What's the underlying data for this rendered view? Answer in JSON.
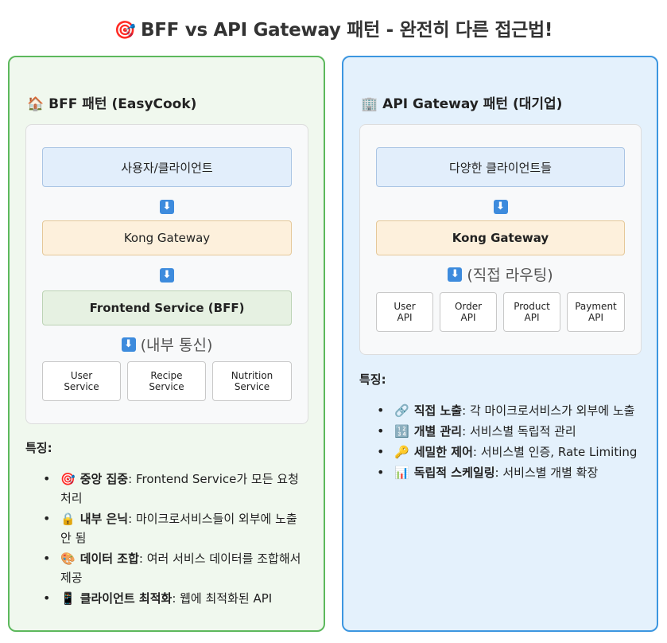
{
  "title": {
    "icon": "🎯",
    "text": "BFF vs API Gateway 패턴 - 완전히 다른 접근법!"
  },
  "bff": {
    "icon": "🏠",
    "title": "BFF 패턴 (EasyCook)",
    "client": "사용자/클라이언트",
    "gateway": "Kong Gateway",
    "frontend": "Frontend Service (BFF)",
    "internal_label": "(내부 통신)",
    "services": [
      "User\nService",
      "Recipe\nService",
      "Nutrition\nService"
    ],
    "features_title": "특징:",
    "features": [
      {
        "icon": "🎯",
        "name": "중앙 집중",
        "desc": ": Frontend Service가 모든 요청 처리"
      },
      {
        "icon": "🔒",
        "name": "내부 은닉",
        "desc": ": 마이크로서비스들이 외부에 노출 안 됨"
      },
      {
        "icon": "🎨",
        "name": "데이터 조합",
        "desc": ": 여러 서비스 데이터를 조합해서 제공"
      },
      {
        "icon": "📱",
        "name": "클라이언트 최적화",
        "desc": ": 웹에 최적화된 API"
      }
    ]
  },
  "gw": {
    "icon": "🏢",
    "title": "API Gateway 패턴 (대기업)",
    "client": "다양한 클라이언트들",
    "gateway": "Kong Gateway",
    "routing_label": "(직접 라우팅)",
    "services": [
      "User\nAPI",
      "Order\nAPI",
      "Product\nAPI",
      "Payment\nAPI"
    ],
    "features_title": "특징:",
    "features": [
      {
        "icon": "🔗",
        "name": "직접 노출",
        "desc": ": 각 마이크로서비스가 외부에 노출"
      },
      {
        "icon": "🔢",
        "name": "개별 관리",
        "desc": ": 서비스별 독립적 관리"
      },
      {
        "icon": "🔑",
        "name": "세밀한 제어",
        "desc": ": 서비스별 인증, Rate Limiting"
      },
      {
        "icon": "📊",
        "name": "독립적 스케일링",
        "desc": ": 서비스별 개별 확장"
      }
    ]
  },
  "colors": {
    "bff_border": "#5cb85c",
    "gw_border": "#3c96e0",
    "arrow": "#3d8bdd"
  },
  "arrow_glyph": "⬇"
}
